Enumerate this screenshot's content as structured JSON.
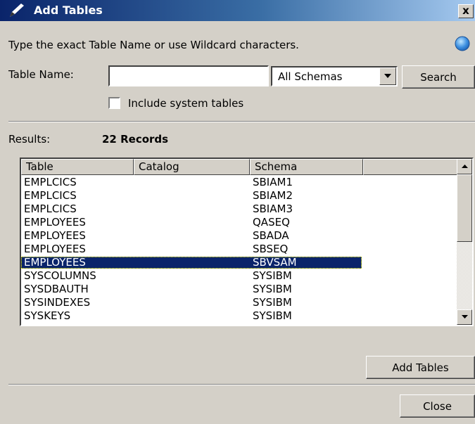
{
  "window": {
    "title": "Add Tables",
    "close_glyph": "x"
  },
  "instructions": "Type the exact Table Name or use Wildcard characters.",
  "form": {
    "table_name_label": "Table Name:",
    "table_name_value": "",
    "schema_selected": "All Schemas",
    "search_label": "Search",
    "include_system_label": "Include system tables",
    "include_system_checked": false
  },
  "results": {
    "label": "Results:",
    "count_text": "22 Records"
  },
  "table": {
    "columns": [
      "Table",
      "Catalog",
      "Schema",
      ""
    ],
    "rows": [
      {
        "table": "EMPLCICS",
        "catalog": "",
        "schema": "SBIAM1"
      },
      {
        "table": "EMPLCICS",
        "catalog": "",
        "schema": "SBIAM2"
      },
      {
        "table": "EMPLCICS",
        "catalog": "",
        "schema": "SBIAM3"
      },
      {
        "table": "EMPLOYEES",
        "catalog": "",
        "schema": "QASEQ"
      },
      {
        "table": "EMPLOYEES",
        "catalog": "",
        "schema": "SBADA"
      },
      {
        "table": "EMPLOYEES",
        "catalog": "",
        "schema": "SBSEQ"
      },
      {
        "table": "EMPLOYEES",
        "catalog": "",
        "schema": "SBVSAM"
      },
      {
        "table": "SYSCOLUMNS",
        "catalog": "",
        "schema": "SYSIBM"
      },
      {
        "table": "SYSDBAUTH",
        "catalog": "",
        "schema": "SYSIBM"
      },
      {
        "table": "SYSINDEXES",
        "catalog": "",
        "schema": "SYSIBM"
      },
      {
        "table": "SYSKEYS",
        "catalog": "",
        "schema": "SYSIBM"
      }
    ],
    "selected_index": 6
  },
  "buttons": {
    "add_tables": "Add Tables",
    "close": "Close"
  },
  "icons": {
    "title": "pencil-icon",
    "help": "help-icon",
    "dropdown": "chevron-down-icon"
  },
  "colors": {
    "selection": "#0a246a",
    "title_start": "#0a246a",
    "title_end": "#a6caf0",
    "face": "#d4d0c8"
  }
}
